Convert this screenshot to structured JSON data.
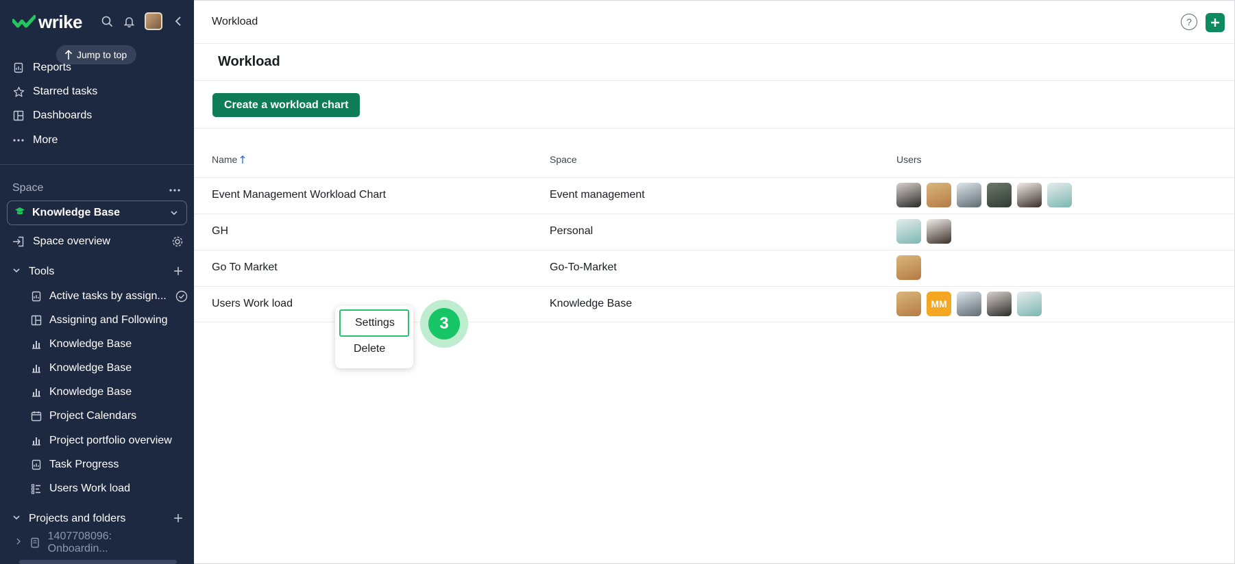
{
  "sidebar": {
    "logo": "wrike",
    "jump_to_top": "Jump to top",
    "nav": [
      {
        "label": "Reports",
        "icon": "report-icon"
      },
      {
        "label": "Starred tasks",
        "icon": "star-icon"
      },
      {
        "label": "Dashboards",
        "icon": "dashboard-icon"
      },
      {
        "label": "More",
        "icon": "more-icon"
      }
    ],
    "space_label": "Space",
    "space_selected": "Knowledge Base",
    "space_overview": "Space overview",
    "tools_label": "Tools",
    "tools": [
      {
        "label": "Active tasks by assign...",
        "icon": "report-icon"
      },
      {
        "label": "Assigning and Following",
        "icon": "dashboard-icon"
      },
      {
        "label": "Knowledge Base",
        "icon": "bar-chart-icon"
      },
      {
        "label": "Knowledge Base",
        "icon": "bar-chart-icon"
      },
      {
        "label": "Knowledge Base",
        "icon": "bar-chart-icon"
      },
      {
        "label": "Project Calendars",
        "icon": "calendar-icon"
      },
      {
        "label": "Project portfolio overview",
        "icon": "bar-chart-icon"
      },
      {
        "label": "Task Progress",
        "icon": "report-icon"
      },
      {
        "label": "Users Work load",
        "icon": "workload-icon"
      }
    ],
    "projects_label": "Projects and folders",
    "projects": [
      {
        "label": "1407708096: Onboardin..."
      }
    ]
  },
  "header": {
    "breadcrumb": "Workload"
  },
  "main": {
    "title": "Workload",
    "create_button": "Create a workload chart",
    "columns": {
      "name": "Name",
      "space": "Space",
      "users": "Users"
    },
    "rows": [
      {
        "name": "Event Management Workload Chart",
        "space": "Event management",
        "users": [
          "avatar",
          "avatar",
          "avatar",
          "avatar",
          "avatar",
          "avatar"
        ]
      },
      {
        "name": "GH",
        "space": "Personal",
        "users": [
          "avatar",
          "avatar"
        ]
      },
      {
        "name": "Go To Market",
        "space": "Go-To-Market",
        "users": [
          "avatar"
        ]
      },
      {
        "name": "Users Work load",
        "space": "Knowledge Base",
        "users": [
          "avatar",
          "MM",
          "avatar",
          "avatar",
          "avatar"
        ]
      }
    ]
  },
  "context_menu": {
    "items": [
      "Settings",
      "Delete"
    ]
  },
  "step_badge": "3",
  "colors": {
    "sidebar_bg": "#1d2841",
    "brand_green": "#0d7c57",
    "step_green": "#17c466",
    "mm_avatar": "#f5a623"
  }
}
